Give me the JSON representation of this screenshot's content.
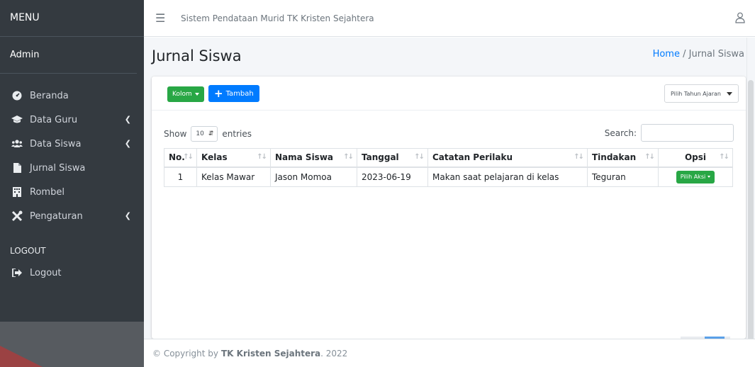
{
  "sidebar": {
    "menu_label": "MENU",
    "user_label": "Admin",
    "items": [
      {
        "label": "Beranda",
        "icon": "tachometer-icon"
      },
      {
        "label": "Data Guru",
        "icon": "graduation-cap-icon"
      },
      {
        "label": "Data Siswa",
        "icon": "users-icon"
      },
      {
        "label": "Jurnal Siswa",
        "icon": "file-icon"
      },
      {
        "label": "Rombel",
        "icon": "building-icon"
      },
      {
        "label": "Pengaturan",
        "icon": "tools-icon"
      }
    ],
    "logout_section": "LOGOUT",
    "logout_label": "Logout"
  },
  "topbar": {
    "title": "Sistem Pendataan Murid TK Kristen Sejahtera"
  },
  "page": {
    "title": "Jurnal Siswa",
    "breadcrumb_home": "Home",
    "breadcrumb_sep": " / ",
    "breadcrumb_current": "Jurnal Siswa"
  },
  "toolbar": {
    "kolom_label": "Kolom",
    "tambah_label": "Tambah",
    "year_select": "Pilih Tahun Ajaran"
  },
  "datatable": {
    "show_label": "Show",
    "length_value": "10",
    "entries_label": "entries",
    "search_label": "Search:",
    "columns": [
      "No.",
      "Kelas",
      "Nama Siswa",
      "Tanggal",
      "Catatan Perilaku",
      "Tindakan",
      "Opsi"
    ],
    "rows": [
      {
        "no": "1",
        "kelas": "Kelas Mawar",
        "nama": "Jason Momoa",
        "tanggal": "2023-06-19",
        "catatan": "Makan saat pelajaran di kelas",
        "tindakan": "Teguran",
        "opsi": "Pilih Aksi"
      }
    ]
  },
  "footer": {
    "prefix": "© Copyright by",
    "brand": "TK Kristen Sejahtera",
    "suffix": ". 2022"
  },
  "colors": {
    "sidebar_bg": "#343a40",
    "primary": "#007bff",
    "success": "#28a745",
    "content_bg": "#f4f6f9"
  }
}
